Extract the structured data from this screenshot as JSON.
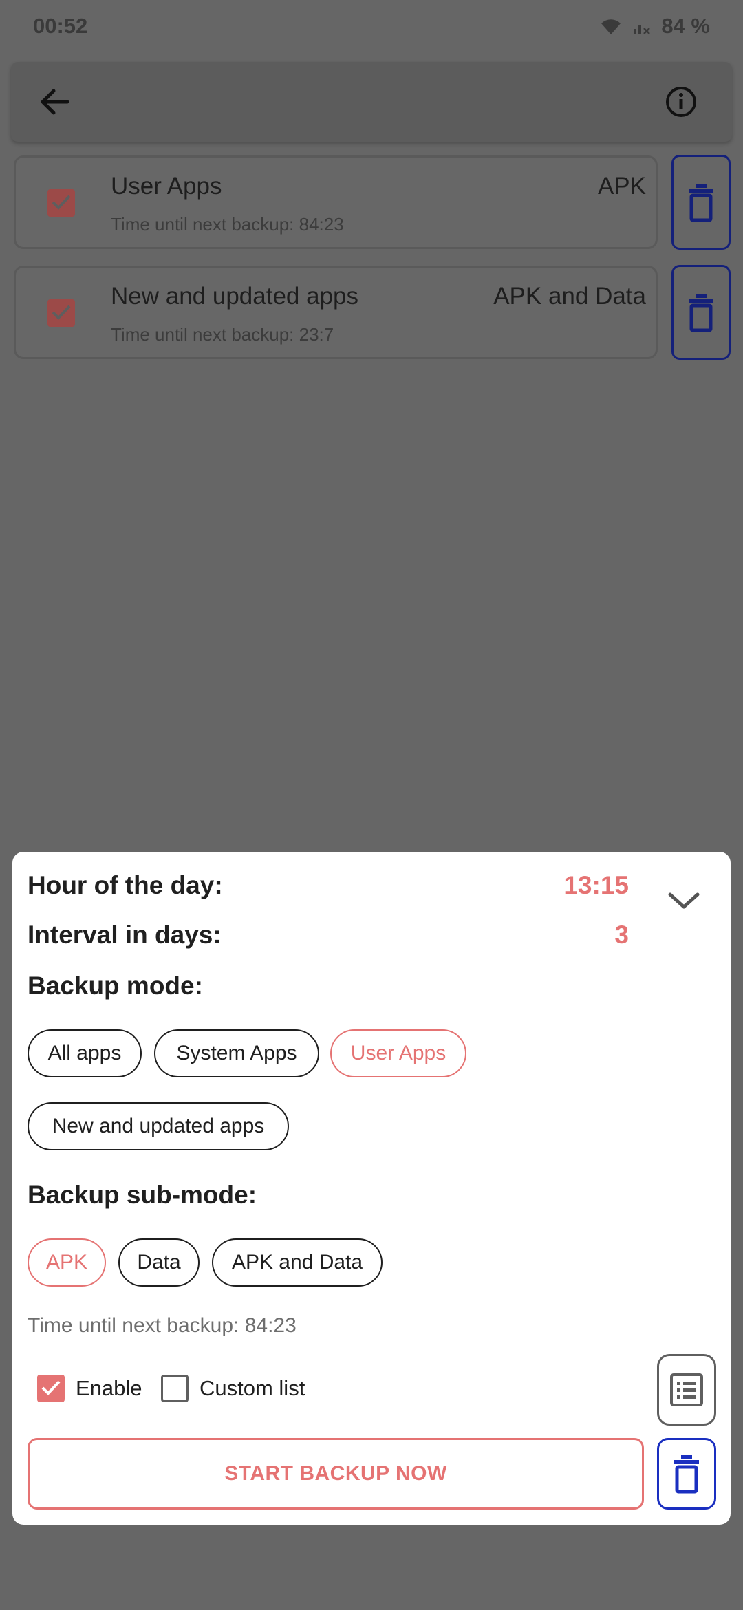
{
  "status_bar": {
    "time": "00:52",
    "battery": "84 %",
    "icons": [
      "wifi-icon",
      "signal-icon"
    ]
  },
  "app_bar": {
    "back_icon": "arrow-left-icon",
    "info_icon": "info-circle-icon"
  },
  "schedules": [
    {
      "title": "User Apps",
      "mode": "APK",
      "next_backup": "Time until next backup: 84:23",
      "enabled": true
    },
    {
      "title": "New and updated apps",
      "mode": "APK and Data",
      "next_backup": "Time until next backup: 23:7",
      "enabled": true
    }
  ],
  "sheet": {
    "hour_label": "Hour of the day:",
    "hour_value": "13:15",
    "interval_label": "Interval in days:",
    "interval_value": "3",
    "backup_mode_label": "Backup mode:",
    "backup_modes": [
      {
        "label": "All apps",
        "selected": false
      },
      {
        "label": "System Apps",
        "selected": false
      },
      {
        "label": "User Apps",
        "selected": true
      },
      {
        "label": "New and updated apps",
        "selected": false
      }
    ],
    "sub_mode_label": "Backup sub-mode:",
    "sub_modes": [
      {
        "label": "APK",
        "selected": true
      },
      {
        "label": "Data",
        "selected": false
      },
      {
        "label": "APK and Data",
        "selected": false
      }
    ],
    "next_backup": "Time until next backup: 84:23",
    "enable_label": "Enable",
    "enable_checked": true,
    "custom_list_label": "Custom list",
    "custom_list_checked": false,
    "start_button": "START BACKUP NOW"
  },
  "colors": {
    "accent": "#e57373",
    "delete_outline": "#1a2fc0",
    "scrim": "#666666"
  }
}
